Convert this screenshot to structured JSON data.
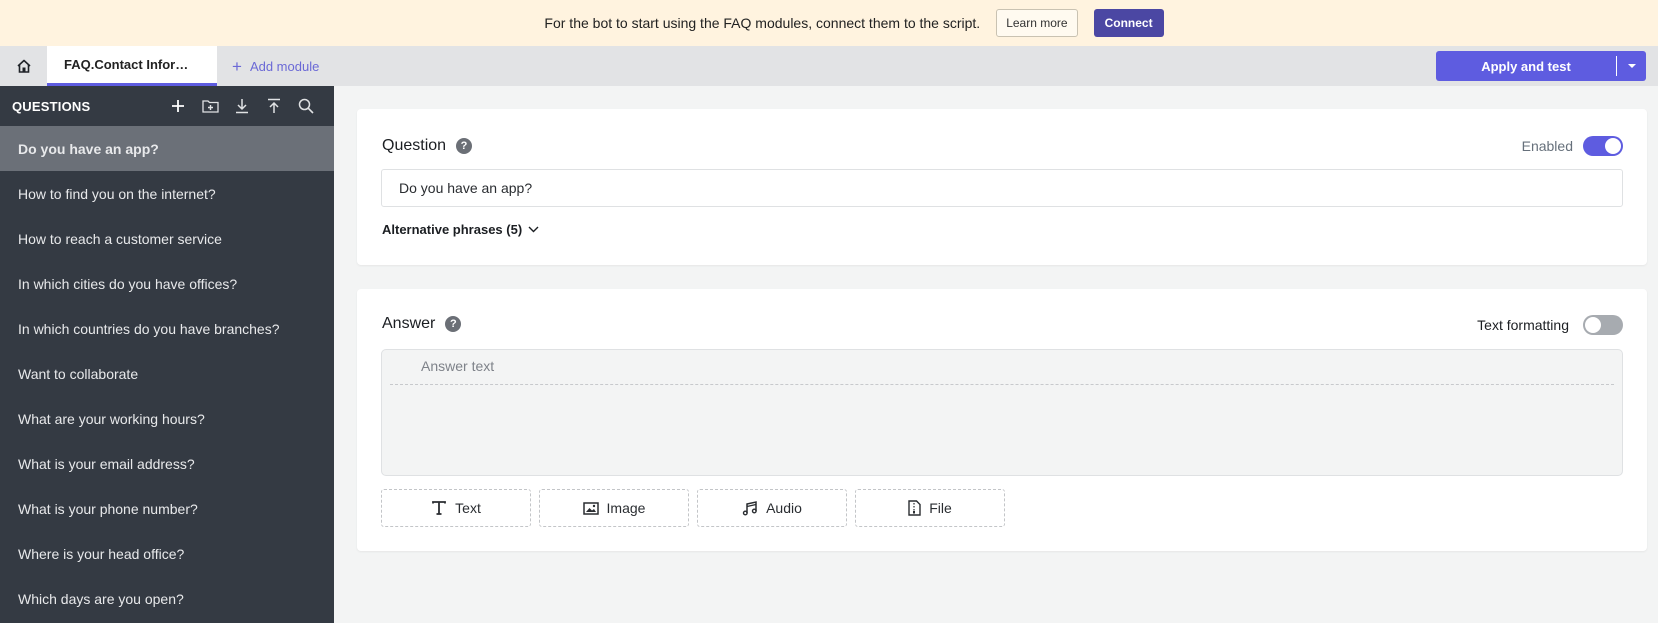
{
  "banner": {
    "message": "For the bot to start using the FAQ modules, connect them to the script.",
    "learn_more_label": "Learn more",
    "connect_label": "Connect"
  },
  "tabs": {
    "home_icon": "home-icon",
    "active_module": "FAQ.Contact Infor…",
    "add_module_label": "Add module",
    "apply_label": "Apply and test"
  },
  "sidebar": {
    "title": "QUESTIONS",
    "icons": [
      "plus-icon",
      "folder-add-icon",
      "download-icon",
      "upload-icon",
      "search-icon"
    ],
    "items": [
      {
        "label": "Do you have an app?",
        "active": true
      },
      {
        "label": "How to find you on the internet?"
      },
      {
        "label": "How to reach a customer service"
      },
      {
        "label": "In which cities do you have offices?"
      },
      {
        "label": "In which countries do you have branches?"
      },
      {
        "label": "Want to collaborate"
      },
      {
        "label": "What are your working hours?"
      },
      {
        "label": "What is your email address?"
      },
      {
        "label": "What is your phone number?"
      },
      {
        "label": "Where is your head office?"
      },
      {
        "label": "Which days are you open?"
      }
    ]
  },
  "question": {
    "title": "Question",
    "enabled_label": "Enabled",
    "enabled": true,
    "value": "Do you have an app?",
    "alt_phrases_label": "Alternative phrases (5)"
  },
  "answer": {
    "title": "Answer",
    "formatting_label": "Text formatting",
    "formatting_enabled": false,
    "placeholder": "Answer text",
    "buttons": [
      {
        "label": "Text",
        "icon": "text-icon"
      },
      {
        "label": "Image",
        "icon": "image-icon"
      },
      {
        "label": "Audio",
        "icon": "audio-icon"
      },
      {
        "label": "File",
        "icon": "file-icon"
      }
    ]
  },
  "colors": {
    "accent": "#5e5ce0",
    "connect": "#4b47a3",
    "banner_bg": "#fff3df",
    "sidebar_bg": "#343a43",
    "sidebar_active": "#6b7078"
  }
}
